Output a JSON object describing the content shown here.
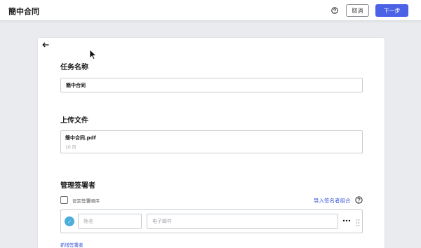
{
  "header": {
    "title": "簡中合同",
    "help_icon": "question-circle-icon",
    "cancel_label": "取消",
    "next_label": "下一步",
    "accent_color": "#4b61e6"
  },
  "card": {
    "back_icon": "arrow-left-icon",
    "task_name": {
      "title": "任务名称",
      "value": "簡中合同"
    },
    "upload": {
      "title": "上传文件",
      "file_name": "簡中合同.pdf",
      "pages": "10 页"
    },
    "signers": {
      "title": "管理签署者",
      "set_order_label": "设定签署顺序",
      "set_order_checked": false,
      "import_label": "导入签名者组合",
      "rows": [
        {
          "avatar_icon": "pen-icon",
          "avatar_color": "#4aaed9",
          "name_placeholder": "姓名",
          "email_placeholder": "电子邮件"
        }
      ],
      "add_signer_label": "新增签署者"
    }
  }
}
